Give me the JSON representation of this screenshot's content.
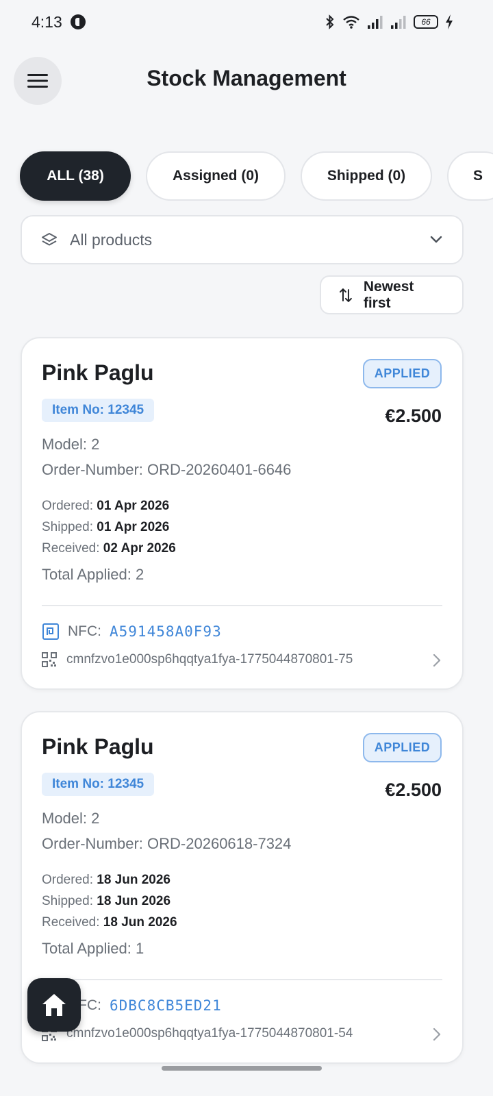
{
  "status_bar": {
    "time": "4:13",
    "battery": "66",
    "icons": [
      "app-icon",
      "bluetooth-icon",
      "wifi-icon",
      "signal-icon",
      "signal-icon",
      "battery-icon",
      "charging-icon"
    ]
  },
  "header": {
    "title": "Stock Management",
    "menu_icon": "hamburger-menu-icon"
  },
  "tabs": [
    {
      "label": "ALL (38)",
      "active": true
    },
    {
      "label": "Assigned (0)",
      "active": false
    },
    {
      "label": "Shipped (0)",
      "active": false
    },
    {
      "label": "S",
      "active": false
    }
  ],
  "product_filter": {
    "selected": "All products",
    "icon": "layers-icon"
  },
  "sort": {
    "label": "Newest first",
    "icon": "sort-arrows-icon"
  },
  "items": [
    {
      "name": "Pink Paglu",
      "status": "APPLIED",
      "item_no": "Item No: 12345",
      "price": "€2.500",
      "model": "Model: 2",
      "order_number": "Order-Number: ORD-20260401-6646",
      "ordered_label": "Ordered:",
      "ordered": "01 Apr 2026",
      "shipped_label": "Shipped:",
      "shipped": "01 Apr 2026",
      "received_label": "Received:",
      "received": "02 Apr 2026",
      "total_applied": "Total Applied: 2",
      "nfc_label": "NFC:",
      "nfc": "A591458A0F93",
      "code": "cmnfzvo1e000sp6hqqtya1fya-1775044870801-75"
    },
    {
      "name": "Pink Paglu",
      "status": "APPLIED",
      "item_no": "Item No: 12345",
      "price": "€2.500",
      "model": "Model: 2",
      "order_number": "Order-Number: ORD-20260618-7324",
      "ordered_label": "Ordered:",
      "ordered": "18 Jun 2026",
      "shipped_label": "Shipped:",
      "shipped": "18 Jun 2026",
      "received_label": "Received:",
      "received": "18 Jun 2026",
      "total_applied": "Total Applied: 1",
      "nfc_label": "NFC:",
      "nfc": "6DBC8CB5ED21",
      "code": "cmnfzvo1e000sp6hqqtya1fya-1775044870801-54"
    }
  ],
  "fab": {
    "icon": "home-icon"
  },
  "colors": {
    "background": "#f5f6f8",
    "primary_dark": "#1f242b",
    "accent_blue": "#3f86d8",
    "badge_bg": "#e6f0fc"
  }
}
